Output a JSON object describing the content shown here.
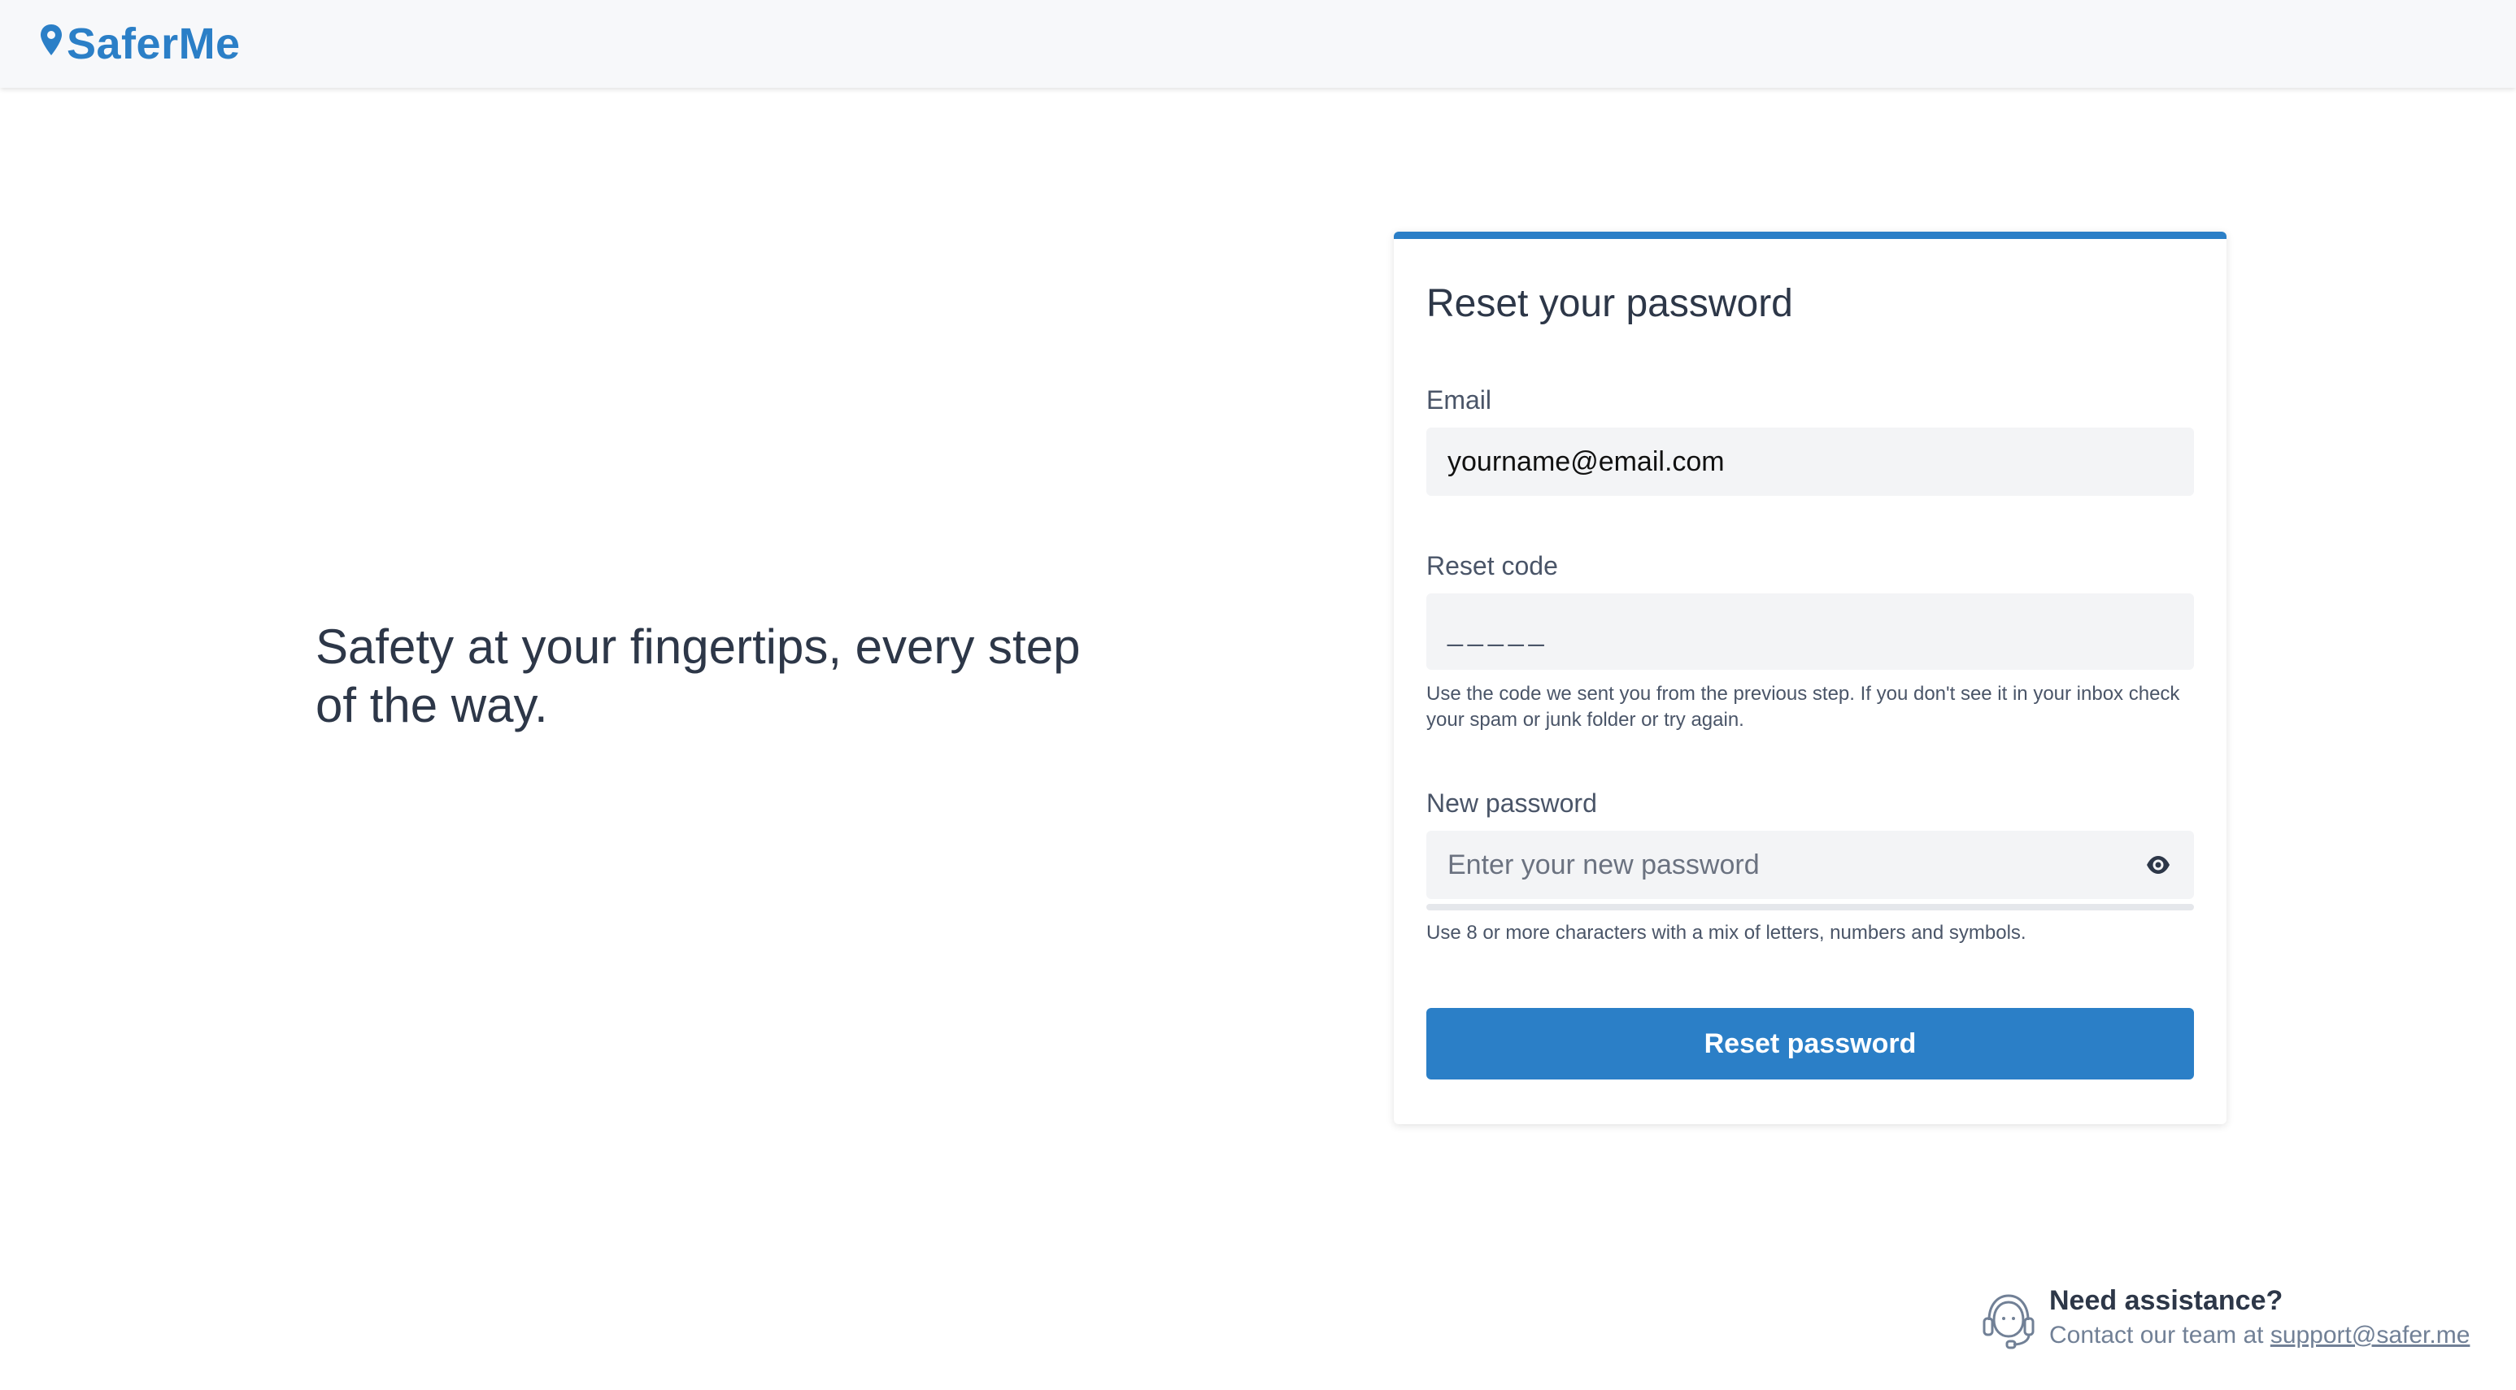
{
  "header": {
    "logo_text": "SaferMe"
  },
  "hero": {
    "tagline": "Safety at your fingertips, every step of the way."
  },
  "form": {
    "title": "Reset your password",
    "email": {
      "label": "Email",
      "value": "yourname@email.com"
    },
    "reset_code": {
      "label": "Reset code",
      "placeholder": "_____",
      "help": "Use the code we sent you from the previous step. If you don't see it in your inbox check your spam or junk folder or try again."
    },
    "new_password": {
      "label": "New password",
      "placeholder": "Enter your new password",
      "help": "Use 8 or more characters with a mix of letters, numbers and symbols.",
      "toggle_icon": "eye-icon"
    },
    "submit_label": "Reset password"
  },
  "assistance": {
    "title": "Need assistance?",
    "text_prefix": "Contact our team at",
    "email": "support@safer.me",
    "icon": "headset-icon"
  },
  "colors": {
    "brand": "#2b7fc7",
    "header_bg": "#f7f8fa",
    "input_bg": "#f3f4f6"
  }
}
